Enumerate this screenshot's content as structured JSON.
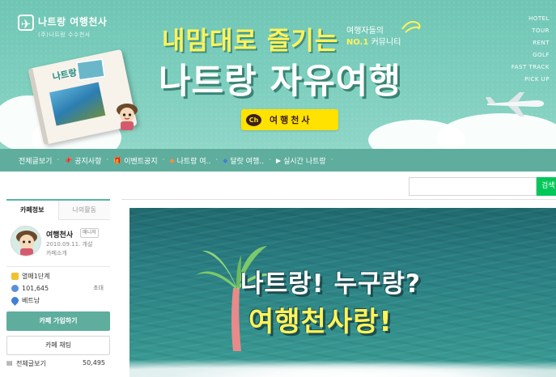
{
  "banner": {
    "logo_title": "나트랑 여행천사",
    "logo_subtitle": "(주)나트랑 수수천사",
    "headline_top": "내맘대로 즐기는",
    "tagline_line1": "여행자들의",
    "tagline_no1": "NO.1",
    "tagline_line2": "커뮤니티",
    "headline_main": "나트랑 자유여행",
    "kakao_icon": "Ch",
    "kakao_label": "여행천사",
    "notebook_title": "나트랑",
    "side_menu": [
      "HOTEL",
      "TOUR",
      "RENT",
      "GOLF",
      "FAST TRACK",
      "PICK UP"
    ],
    "accent_color": "#ffe200"
  },
  "nav": {
    "items": [
      {
        "label": "전체글보기",
        "icon": ""
      },
      {
        "label": "공지사항",
        "icon": "pin-icon"
      },
      {
        "label": "이벤트공지",
        "icon": "gift-icon"
      },
      {
        "label": "나트랑 여..",
        "icon": "diamond-icon"
      },
      {
        "label": "달랏 여행..",
        "icon": "diamond-icon"
      },
      {
        "label": "실시간 나트랑",
        "icon": "play-icon"
      }
    ],
    "bar_color": "#5fae9d"
  },
  "search": {
    "placeholder": "",
    "button_label": "검색"
  },
  "sidebar": {
    "tabs": [
      "카페정보",
      "나의활동"
    ],
    "cafe_name": "여행천사",
    "manager_badge": "매니저",
    "created_date": "2010.09.11. 개설",
    "intro_link": "카페소개",
    "level": "열매1단계",
    "members": "101,645",
    "invite_label": "초대",
    "location": "베트남",
    "join_button": "카페 가입하기",
    "chat_button": "카페 채팅",
    "all_posts_label": "전체글보기",
    "all_posts_count": "50,495"
  },
  "hero": {
    "line1": "나트랑! 누구랑?",
    "line2": "여행천사랑!"
  }
}
